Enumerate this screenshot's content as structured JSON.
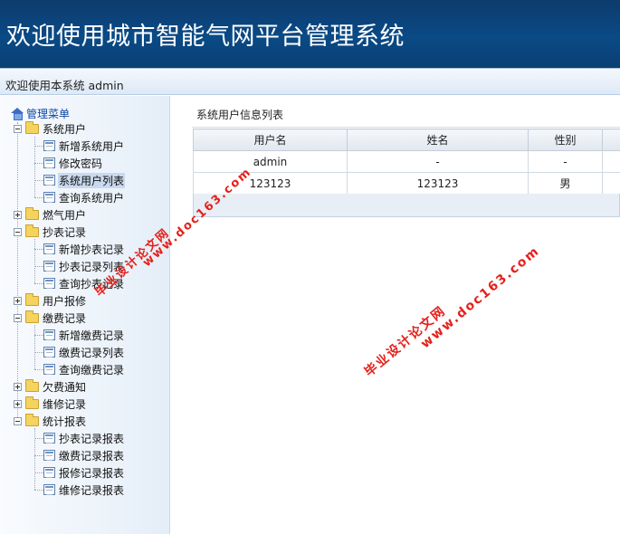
{
  "header": {
    "title": "欢迎使用城市智能气网平台管理系统",
    "welcome": "欢迎使用本系统  admin"
  },
  "sidebar": {
    "root_label": "管理菜单",
    "groups": [
      {
        "label": "系统用户",
        "items": [
          "新增系统用户",
          "修改密码",
          "系统用户列表",
          "查询系统用户"
        ]
      },
      {
        "label": "燃气用户"
      },
      {
        "label": "抄表记录",
        "items": [
          "新增抄表记录",
          "抄表记录列表",
          "查询抄表记录"
        ]
      },
      {
        "label": "用户报修"
      },
      {
        "label": "缴费记录",
        "items": [
          "新增缴费记录",
          "缴费记录列表",
          "查询缴费记录"
        ]
      },
      {
        "label": "欠费通知"
      },
      {
        "label": "维修记录"
      },
      {
        "label": "统计报表",
        "items": [
          "抄表记录报表",
          "缴费记录报表",
          "报修记录报表",
          "维修记录报表"
        ]
      }
    ],
    "selected_item": "系统用户列表"
  },
  "main": {
    "title": "系统用户信息列表",
    "table": {
      "columns": [
        "用户名",
        "姓名",
        "性别",
        ""
      ],
      "rows": [
        [
          "admin",
          "-",
          "-",
          ""
        ],
        [
          "123123",
          "123123",
          "男",
          ""
        ]
      ]
    }
  },
  "watermarks": [
    {
      "line1": "毕业设计论文网",
      "line2": "www.doc163.com"
    },
    {
      "line1": "毕业设计论文网",
      "line2": "www.doc163.com"
    }
  ],
  "colors": {
    "banner": "#0a4a86",
    "watermark": "#e6201a",
    "tree_link": "#0d47a1"
  }
}
